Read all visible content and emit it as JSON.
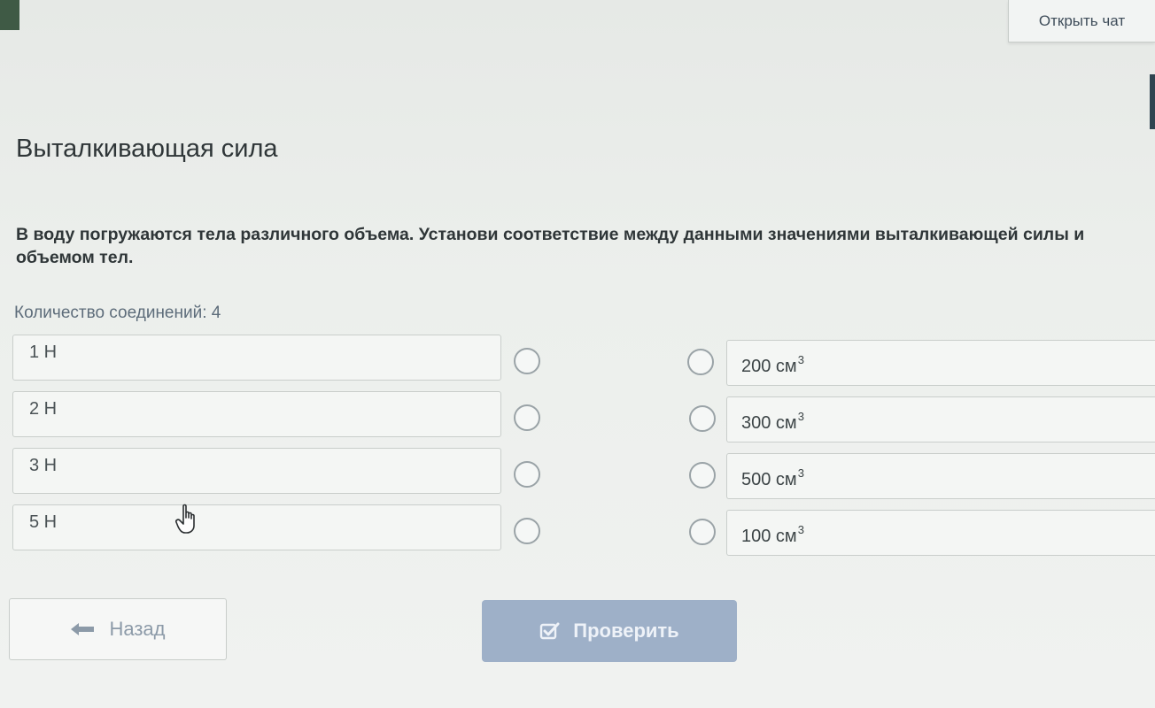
{
  "header": {
    "chat_label": "Открыть чат"
  },
  "page": {
    "title": "Выталкивающая сила",
    "question": "В воду погружаются тела различного объема. Установи соответствие между данными значениями выталкивающей силы и объемом тел.",
    "connections_count_label": "Количество соединений: 4"
  },
  "matching": {
    "left_items": [
      {
        "label": "1 Н"
      },
      {
        "label": "2 Н"
      },
      {
        "label": "3 Н"
      },
      {
        "label": "5 Н"
      }
    ],
    "right_items": [
      {
        "value": "200 см",
        "exponent": "3"
      },
      {
        "value": "300 см",
        "exponent": "3"
      },
      {
        "value": "500 см",
        "exponent": "3"
      },
      {
        "value": "100 см",
        "exponent": "3"
      }
    ]
  },
  "footer": {
    "back_label": "Назад",
    "check_label": "Проверить"
  },
  "icons": {
    "back": "arrow-left-icon",
    "check": "checkbox-check-icon",
    "cursor": "hand-pointer-icon"
  },
  "colors": {
    "check_button_bg": "#9eb0c8",
    "accent_text": "#5d6c7a",
    "page_bg": "#eceeec"
  }
}
